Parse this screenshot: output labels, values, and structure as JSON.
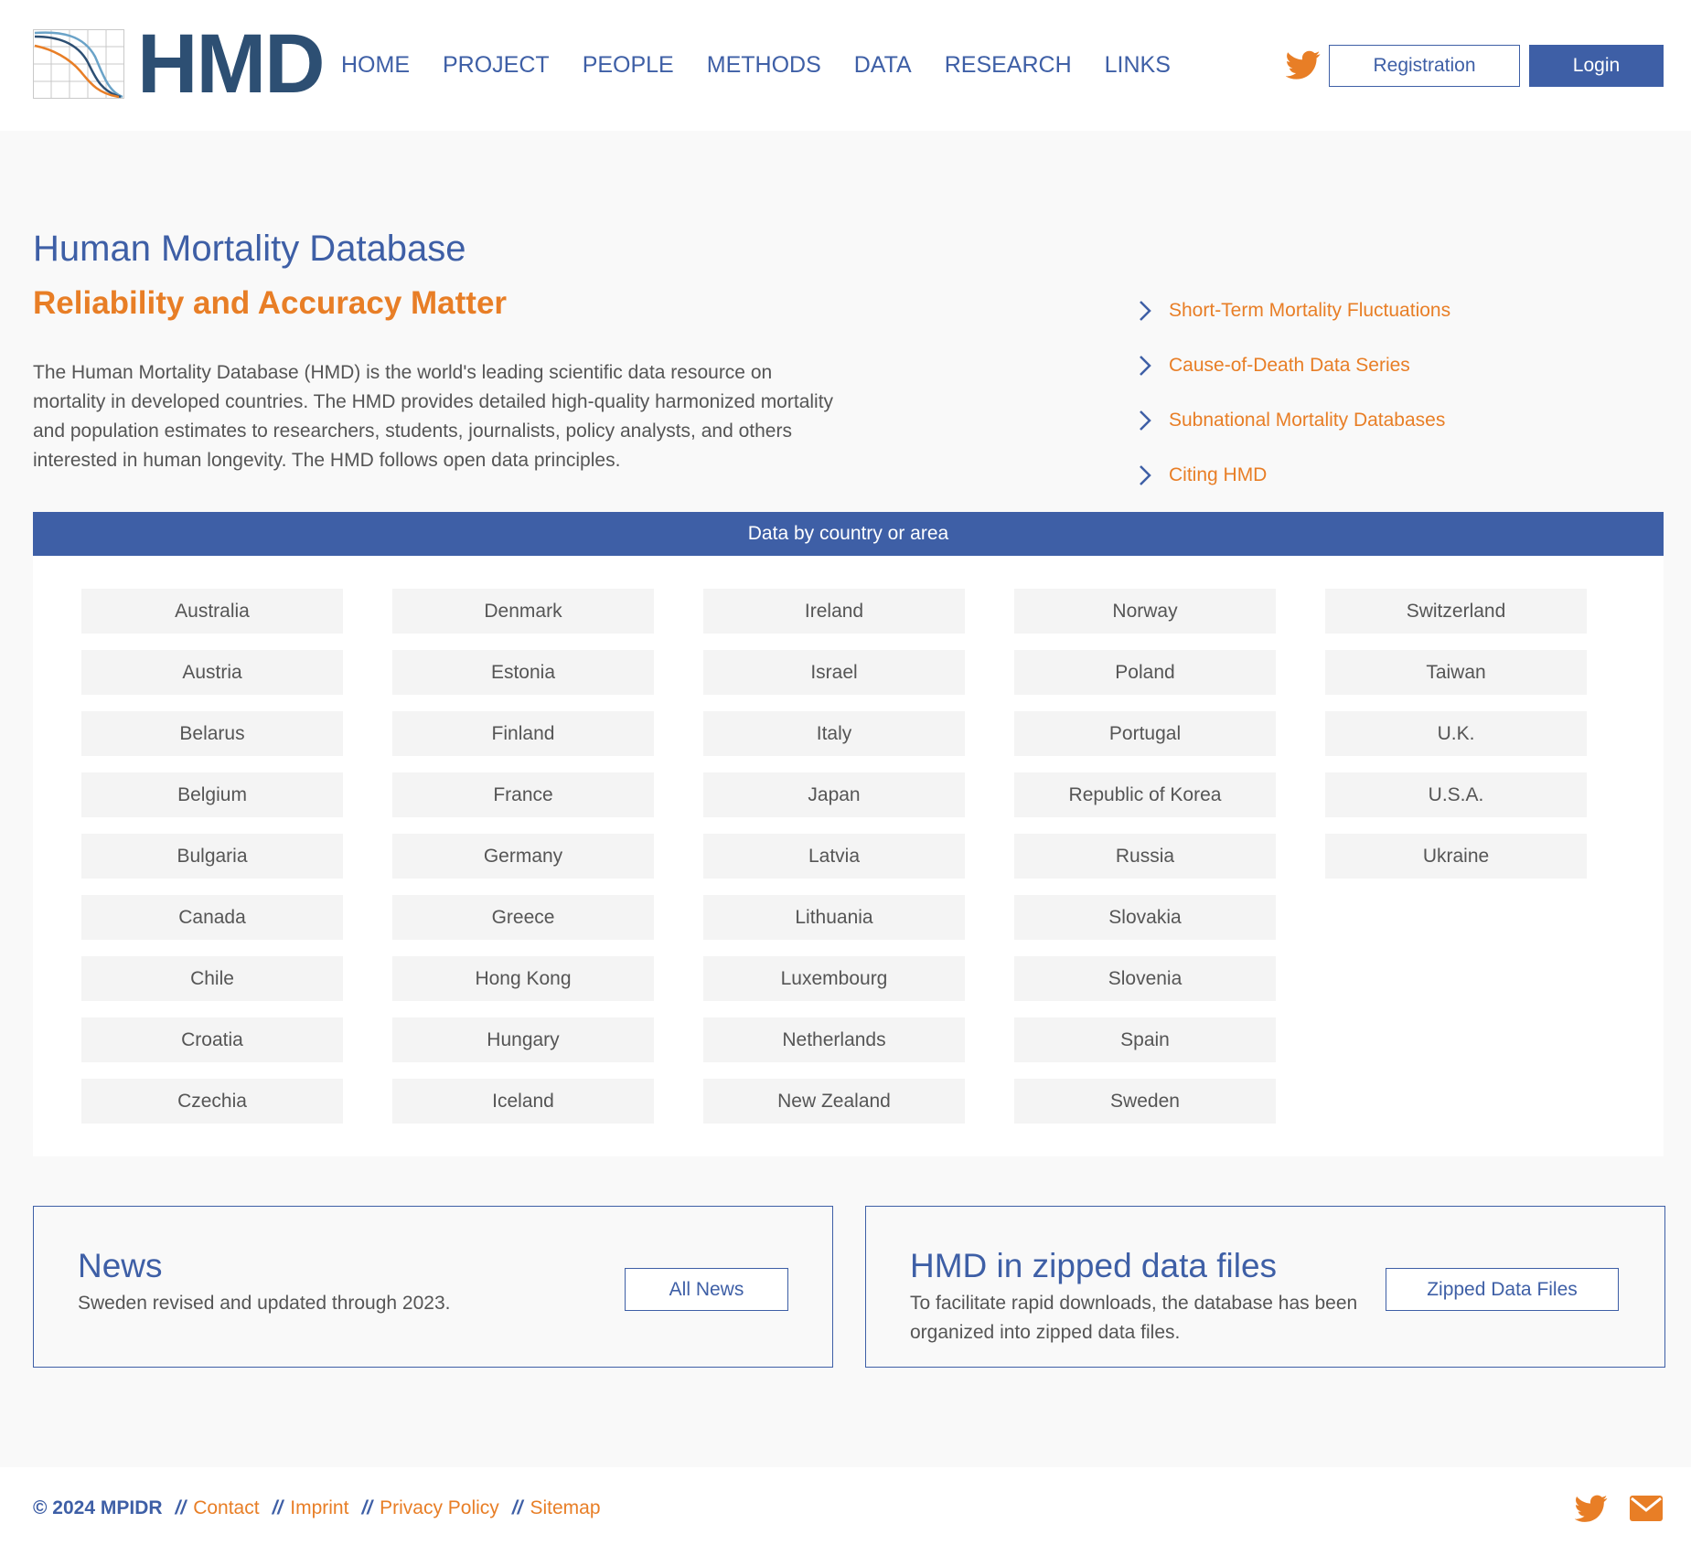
{
  "brand": {
    "logo_text": "HMD"
  },
  "nav": [
    "HOME",
    "PROJECT",
    "PEOPLE",
    "METHODS",
    "DATA",
    "RESEARCH",
    "LINKS"
  ],
  "header_actions": {
    "registration": "Registration",
    "login": "Login"
  },
  "hero": {
    "title": "Human Mortality Database",
    "subtitle": "Reliability and Accuracy Matter",
    "text": "The Human Mortality Database (HMD) is the world's leading scientific data resource on mortality in developed countries. The HMD provides detailed high-quality harmonized mortality and population estimates to researchers, students, journalists, policy analysts, and others interested in human longevity. The HMD follows open data principles."
  },
  "quick_links": [
    "Short-Term Mortality Fluctuations",
    "Cause-of-Death Data Series",
    "Subnational Mortality Databases",
    "Citing HMD"
  ],
  "countries": {
    "heading": "Data by country or area",
    "columns": [
      [
        "Australia",
        "Austria",
        "Belarus",
        "Belgium",
        "Bulgaria",
        "Canada",
        "Chile",
        "Croatia",
        "Czechia"
      ],
      [
        "Denmark",
        "Estonia",
        "Finland",
        "France",
        "Germany",
        "Greece",
        "Hong Kong",
        "Hungary",
        "Iceland"
      ],
      [
        "Ireland",
        "Israel",
        "Italy",
        "Japan",
        "Latvia",
        "Lithuania",
        "Luxembourg",
        "Netherlands",
        "New Zealand"
      ],
      [
        "Norway",
        "Poland",
        "Portugal",
        "Republic of Korea",
        "Russia",
        "Slovakia",
        "Slovenia",
        "Spain",
        "Sweden"
      ],
      [
        "Switzerland",
        "Taiwan",
        "U.K.",
        "U.S.A.",
        "Ukraine"
      ]
    ]
  },
  "news": {
    "title": "News",
    "text": "Sweden revised and updated through 2023.",
    "button": "All News"
  },
  "zipped": {
    "title": "HMD in zipped data files",
    "text": "To facilitate rapid downloads, the database has been organized into zipped data files.",
    "button": "Zipped Data Files"
  },
  "footer": {
    "copyright": "© 2024 MPIDR",
    "separator": "//",
    "links": [
      "Contact",
      "Imprint",
      "Privacy Policy",
      "Sitemap"
    ]
  },
  "icons": {
    "header": [
      "twitter-icon"
    ],
    "quick_link": "chevron-right-icon",
    "footer": [
      "twitter-icon",
      "mail-icon"
    ]
  },
  "colors": {
    "primary": "#3e5fa6",
    "accent": "#e87e26",
    "logo_text": "#2d4f73",
    "page_bg": "#f9f9f9"
  }
}
